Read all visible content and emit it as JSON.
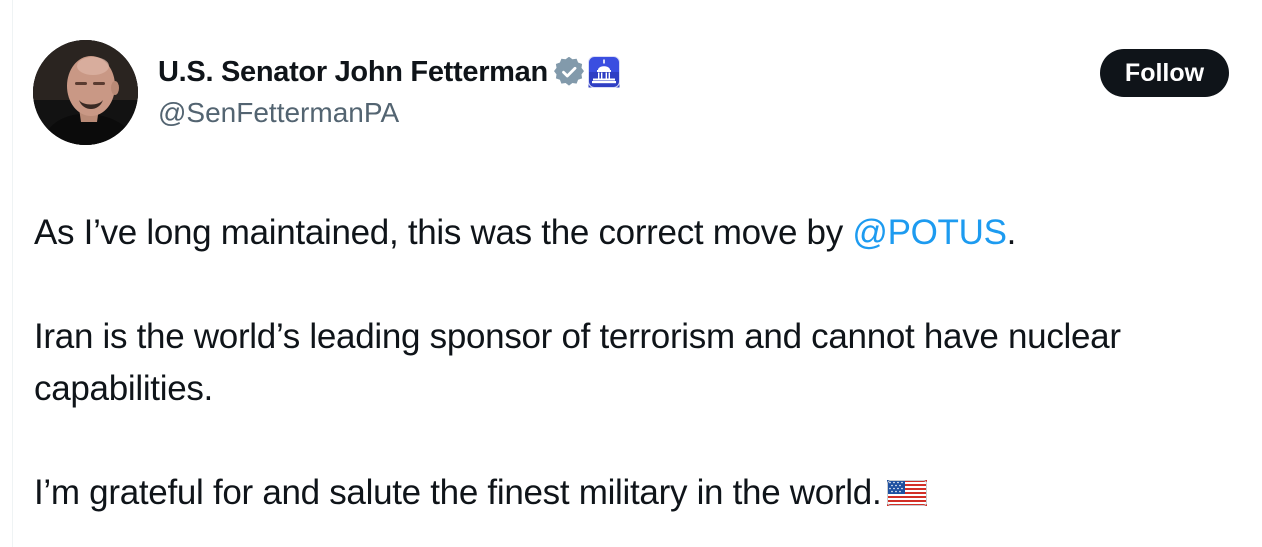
{
  "author": {
    "display_name": "U.S. Senator John Fetterman",
    "handle": "@SenFettermanPA",
    "avatar_icon": "avatar-photo",
    "verified_icon": "verified-badge-icon",
    "affiliation_icon": "capitol-affiliation-icon"
  },
  "follow_button": {
    "label": "Follow"
  },
  "tweet": {
    "para1_before": "As I’ve long maintained, this was the correct move by ",
    "para1_mention": "@POTUS",
    "para1_after": ".",
    "para2": "Iran is the world’s leading sponsor of terrorism and cannot have nuclear capabilities.",
    "para3": "I’m grateful for and salute the finest military in the world.",
    "para3_emoji": "us-flag-icon"
  },
  "colors": {
    "mention": "#1d9bf0",
    "verified_badge": "#829aab",
    "affiliation_badge": "#3a4ee0",
    "button_bg": "#0f1419",
    "handle": "#536471"
  }
}
